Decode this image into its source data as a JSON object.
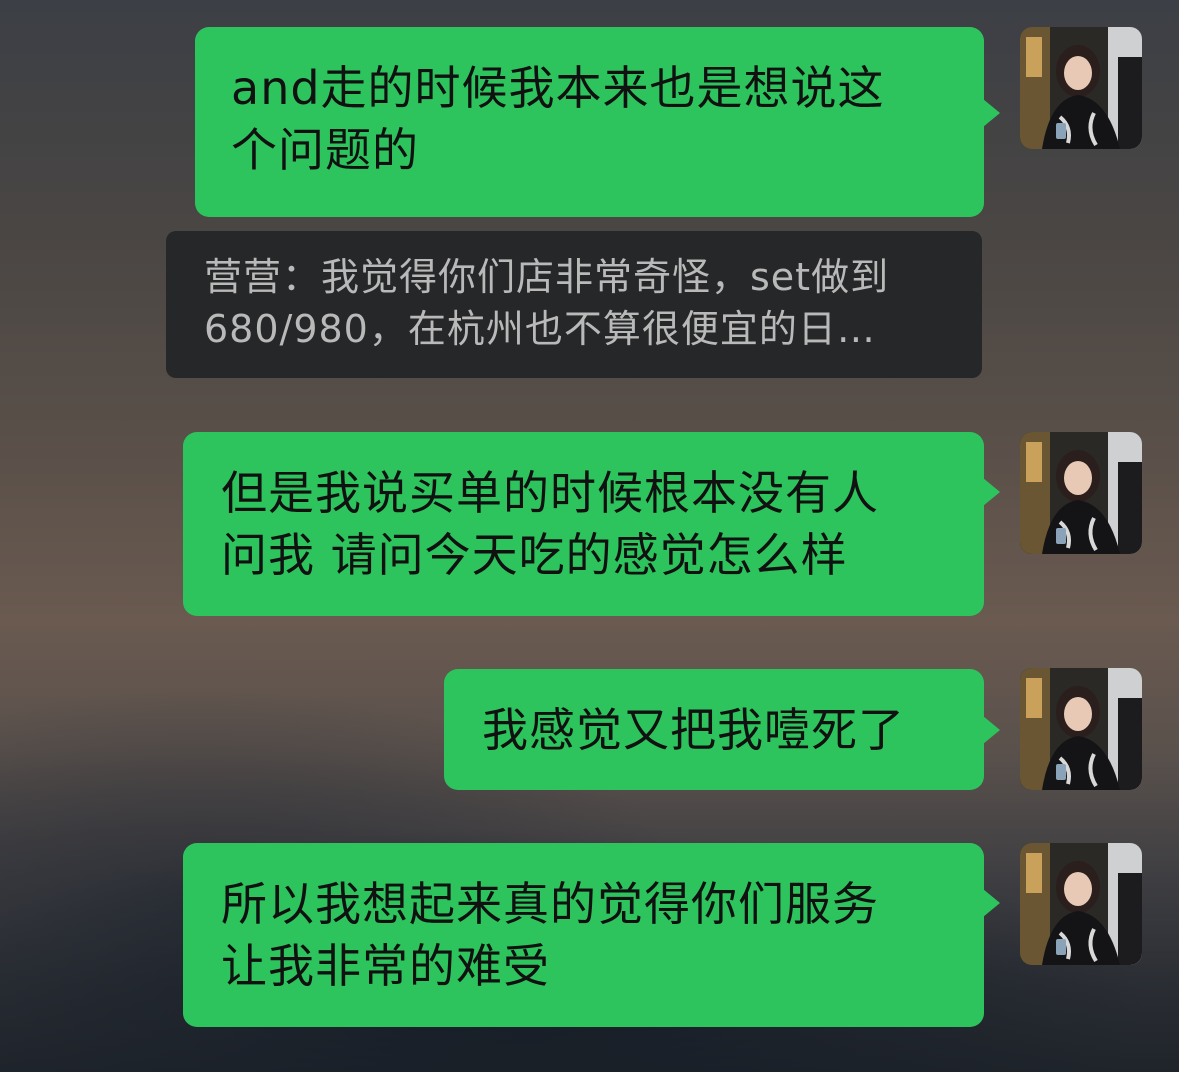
{
  "messages": [
    {
      "line1": "and走的时候我本来也是想说这",
      "line2": "个问题的"
    },
    {
      "line1": "但是我说买单的时候根本没有人",
      "line2": "问我 请问今天吃的感觉怎么样"
    },
    {
      "line1": "我感觉又把我噎死了"
    },
    {
      "line1": "所以我想起来真的觉得你们服务",
      "line2": "让我非常的难受"
    }
  ],
  "quote": {
    "line1": "营营：我觉得你们店非常奇怪，set做到",
    "line2": "680/980，在杭州也不算很便宜的日…"
  },
  "colors": {
    "bubble": "#2ec45d",
    "quote_bg": "#262729",
    "quote_text": "#b9b9b9"
  }
}
